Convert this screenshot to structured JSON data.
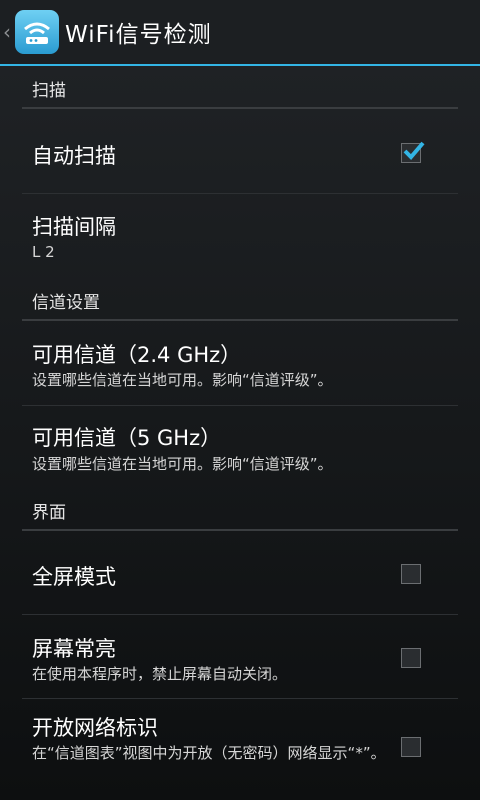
{
  "app": {
    "title": "WiFi信号检测"
  },
  "categories": {
    "scan": "扫描",
    "channel": "信道设置",
    "ui": "界面"
  },
  "prefs": {
    "auto_scan": {
      "title": "自动扫描",
      "checked": true
    },
    "scan_interval": {
      "title": "扫描间隔",
      "summary": "L 2"
    },
    "channels_24": {
      "title": "可用信道（2.4 GHz）",
      "summary": "设置哪些信道在当地可用。影响“信道评级”。"
    },
    "channels_5": {
      "title": "可用信道（5 GHz）",
      "summary": "设置哪些信道在当地可用。影响“信道评级”。"
    },
    "fullscreen": {
      "title": "全屏模式",
      "checked": false
    },
    "keep_screen_on": {
      "title": "屏幕常亮",
      "summary": "在使用本程序时，禁止屏幕自动关闭。",
      "checked": false
    },
    "mark_open": {
      "title": "开放网络标识",
      "summary": "在“信道图表”视图中为开放（无密码）网络显示“*”。",
      "checked": false
    }
  },
  "colors": {
    "accent": "#33b5e5",
    "background": "#101214"
  },
  "icons": {
    "app": "wifi-router-icon",
    "up": "back-caret-icon",
    "check": "checkmark-icon"
  }
}
